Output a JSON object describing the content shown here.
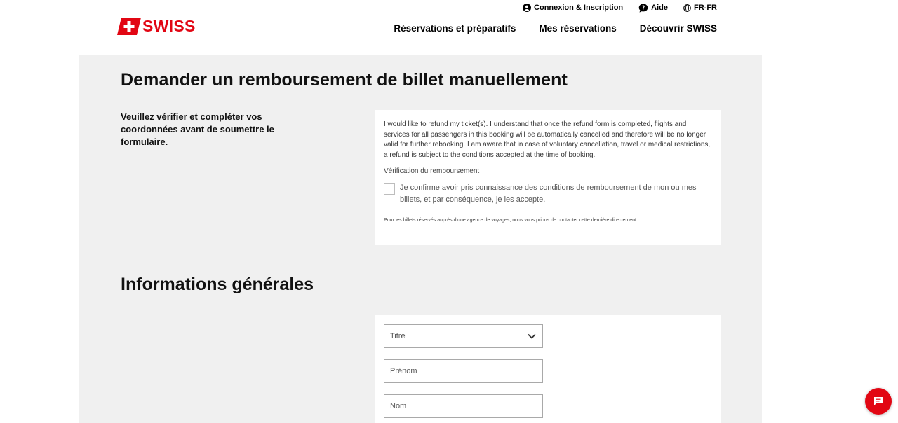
{
  "brand": {
    "name": "SWISS",
    "logo_icon": "swiss-cross-flag-icon",
    "color": "#e20613"
  },
  "utility_nav": [
    {
      "label": "Connexion & Inscription",
      "icon": "user-icon"
    },
    {
      "label": "Aide",
      "icon": "help-chat-icon"
    },
    {
      "label": "FR-FR",
      "icon": "globe-icon"
    }
  ],
  "main_nav": [
    {
      "label": "Réservations et préparatifs"
    },
    {
      "label": "Mes réservations"
    },
    {
      "label": "Découvrir SWISS"
    }
  ],
  "refund_section": {
    "title": "Demander un remboursement de billet manuellement",
    "intro": "Veuillez vérifier et compléter vos coordonnées avant de soumettre le formulaire.",
    "disclaimer": "I would like to refund my ticket(s). I understand that once the refund form is completed, flights and services for all passengers in this booking will be automatically cancelled and therefore will be no longer valid for further rebooking. I am aware that in case of voluntary cancellation, travel or medical restrictions, a refund is subject to the conditions accepted at the time of booking.",
    "verification_label": "Vérification du remboursement",
    "checkbox_label": "Je confirme avoir pris connaissance des conditions de remboursement de mon ou mes billets, et par conséquence, je les accepte.",
    "checkbox_checked": false,
    "agency_note": "Pour les billets réservés auprès d’une agence de voyages, nous vous prions de contacter cette dernière directement."
  },
  "general_info": {
    "title": "Informations générales",
    "title_select": {
      "value": "",
      "placeholder": "Titre"
    },
    "first_name": {
      "value": "",
      "placeholder": "Prénom"
    },
    "last_name": {
      "value": "",
      "placeholder": "Nom"
    }
  },
  "chat_button": {
    "icon": "chat-message-icon",
    "color": "#e20613"
  }
}
